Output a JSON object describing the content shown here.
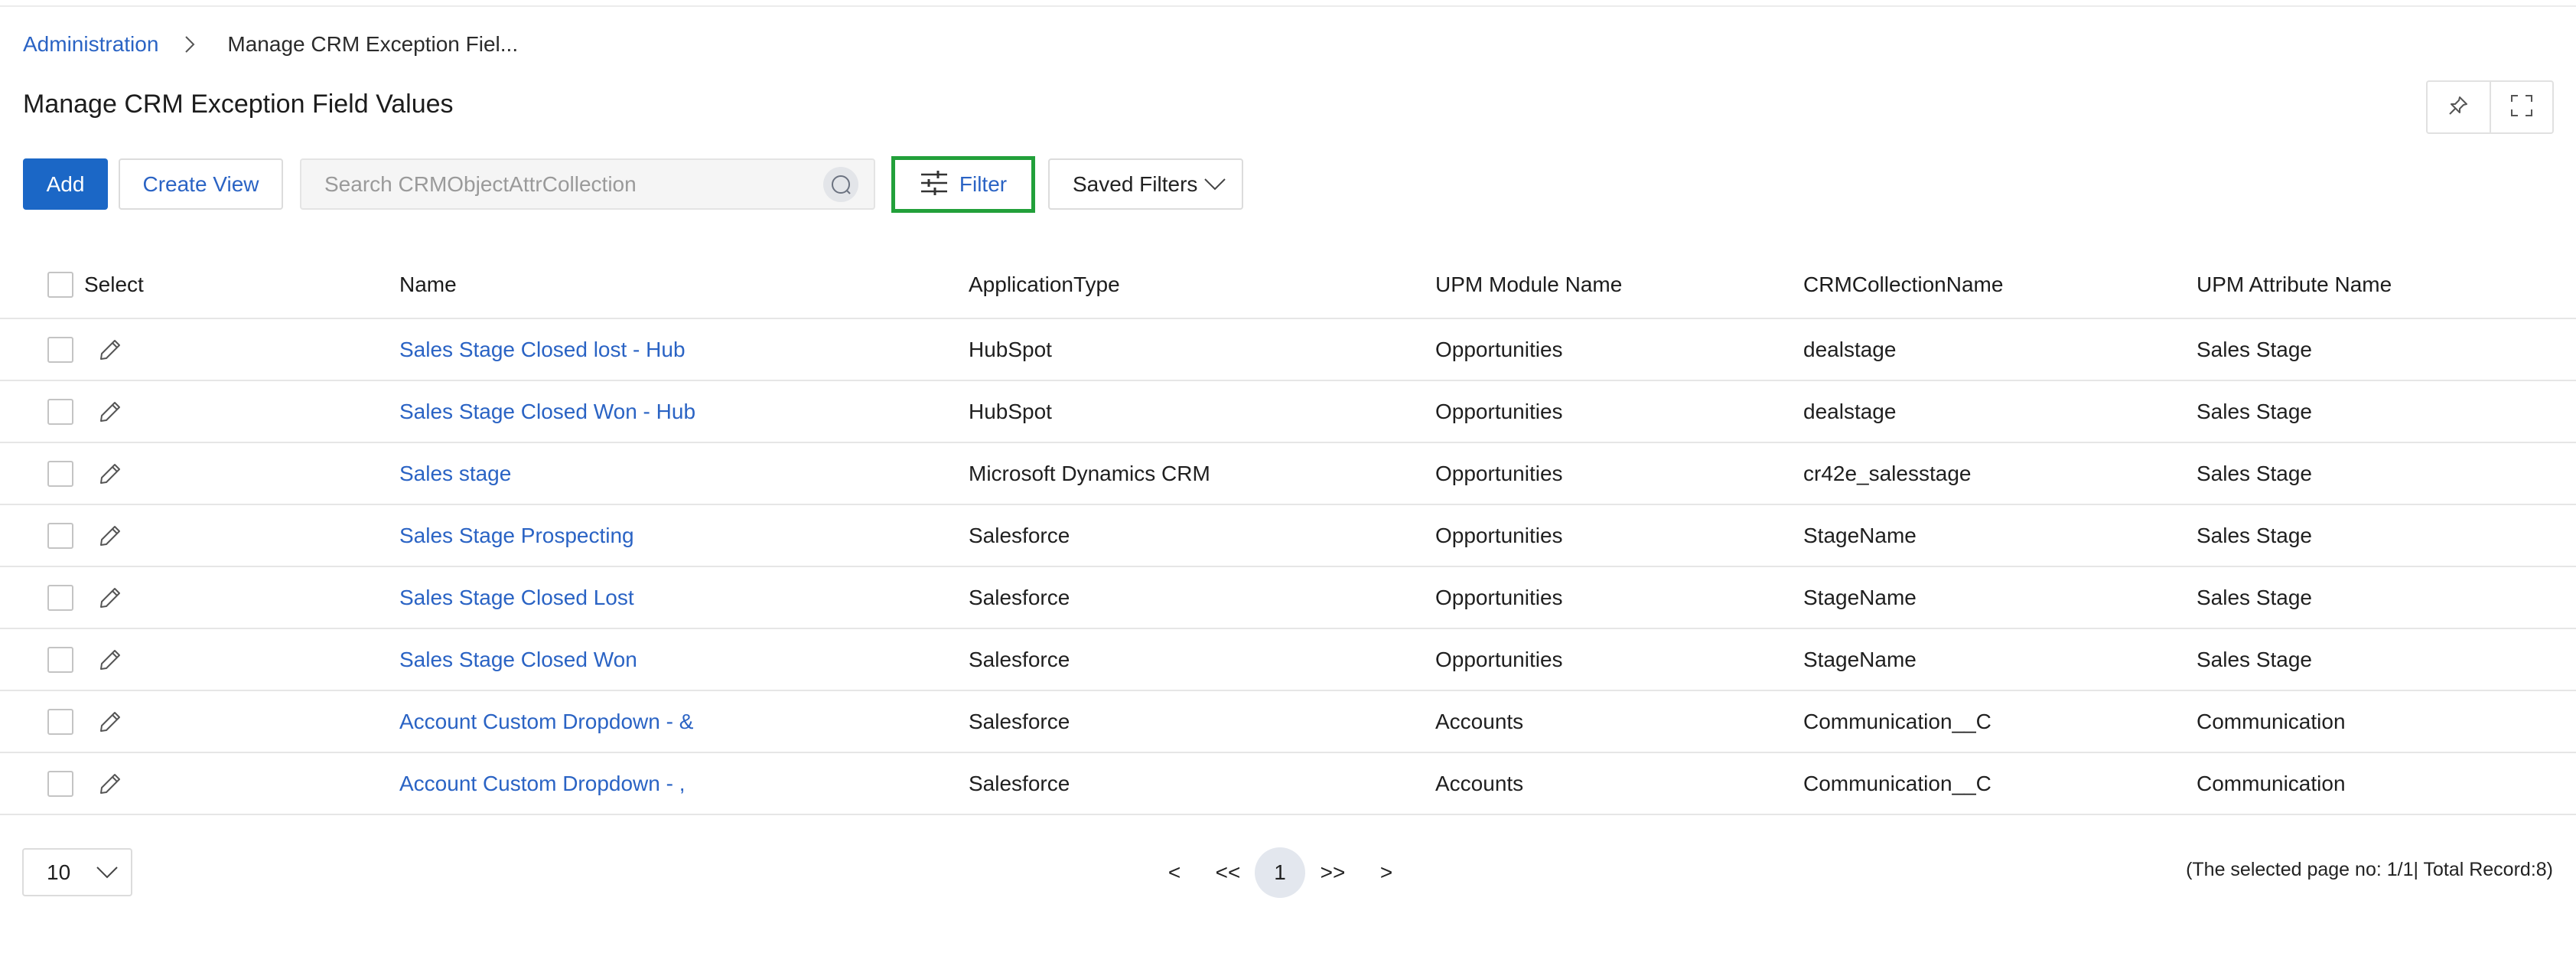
{
  "breadcrumb": {
    "parent": "Administration",
    "current": "Manage CRM Exception Fiel..."
  },
  "page": {
    "title": "Manage CRM Exception Field Values"
  },
  "toolbar": {
    "add_label": "Add",
    "create_view_label": "Create View",
    "search_placeholder": "Search CRMObjectAttrCollection",
    "filter_label": "Filter",
    "saved_filters_label": "Saved Filters"
  },
  "table": {
    "headers": {
      "select": "Select",
      "name": "Name",
      "application_type": "ApplicationType",
      "module": "UPM Module Name",
      "collection": "CRMCollectionName",
      "attribute": "UPM Attribute Name"
    },
    "rows": [
      {
        "name": "Sales Stage Closed lost - Hub",
        "application_type": "HubSpot",
        "module": "Opportunities",
        "collection": "dealstage",
        "attribute": "Sales Stage"
      },
      {
        "name": "Sales Stage Closed Won - Hub",
        "application_type": "HubSpot",
        "module": "Opportunities",
        "collection": "dealstage",
        "attribute": "Sales Stage"
      },
      {
        "name": "Sales stage",
        "application_type": "Microsoft Dynamics CRM",
        "module": "Opportunities",
        "collection": "cr42e_salesstage",
        "attribute": "Sales Stage"
      },
      {
        "name": "Sales Stage Prospecting",
        "application_type": "Salesforce",
        "module": "Opportunities",
        "collection": "StageName",
        "attribute": "Sales Stage"
      },
      {
        "name": "Sales Stage Closed Lost",
        "application_type": "Salesforce",
        "module": "Opportunities",
        "collection": "StageName",
        "attribute": "Sales Stage"
      },
      {
        "name": "Sales Stage Closed Won",
        "application_type": "Salesforce",
        "module": "Opportunities",
        "collection": "StageName",
        "attribute": "Sales Stage"
      },
      {
        "name": "Account Custom Dropdown - &",
        "application_type": "Salesforce",
        "module": "Accounts",
        "collection": "Communication__C",
        "attribute": "Communication"
      },
      {
        "name": "Account Custom Dropdown - ,",
        "application_type": "Salesforce",
        "module": "Accounts",
        "collection": "Communication__C",
        "attribute": "Communication"
      }
    ]
  },
  "pagination": {
    "page_size": "10",
    "prev": "<",
    "first": "<<",
    "current_page": "1",
    "last": ">>",
    "next": ">",
    "status": "(The selected page no: 1/1| Total Record:8)"
  },
  "colors": {
    "accent": "#1b67c6",
    "link": "#2a63c4",
    "filter_highlight": "#22a03a"
  }
}
